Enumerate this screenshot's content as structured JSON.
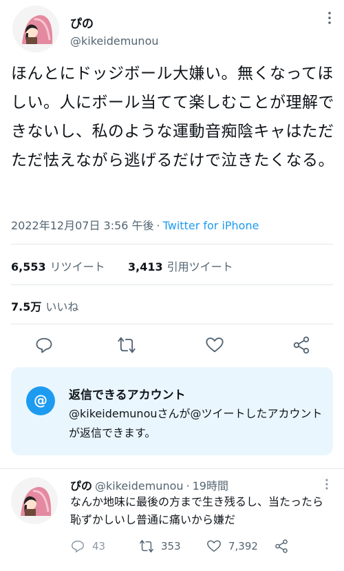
{
  "tweet": {
    "display_name": "ぴの",
    "handle": "@kikeidemunou",
    "text": "ほんとにドッジボール大嫌い。無くなってほしい。人にボール当てて楽しむことが理解できないし、私のような運動音痴陰キャはただただ怯えながら逃げるだけで泣きたくなる。",
    "timestamp": "2022年12月07日 3:56 午後",
    "separator": "·",
    "client": "Twitter for iPhone"
  },
  "stats": {
    "retweets_count": "6,553",
    "retweets_label": "リツイート",
    "quotes_count": "3,413",
    "quotes_label": "引用ツイート",
    "likes_count": "7.5万",
    "likes_label": "いいね"
  },
  "actions": [
    "reply-icon",
    "retweet-icon",
    "like-icon",
    "share-icon"
  ],
  "reply_restriction": {
    "icon_text": "@",
    "title": "返信できるアカウント",
    "description": "@kikeidemunouさんが@ツイートしたアカウントが返信できます。"
  },
  "reply": {
    "display_name": "ぴの",
    "handle": "@kikeidemunou",
    "separator": "·",
    "time": "19時間",
    "text": "なんか地味に最後の方まで生き残るし、当たったら恥ずかしいし普通に痛いから嫌だ",
    "reply_count": "43",
    "retweet_count": "353",
    "like_count": "7,392"
  },
  "colors": {
    "accent": "#1d9bf0",
    "secondary_text": "#536471",
    "card_bg": "#eaf6fe",
    "divider": "#e3e7ea"
  }
}
